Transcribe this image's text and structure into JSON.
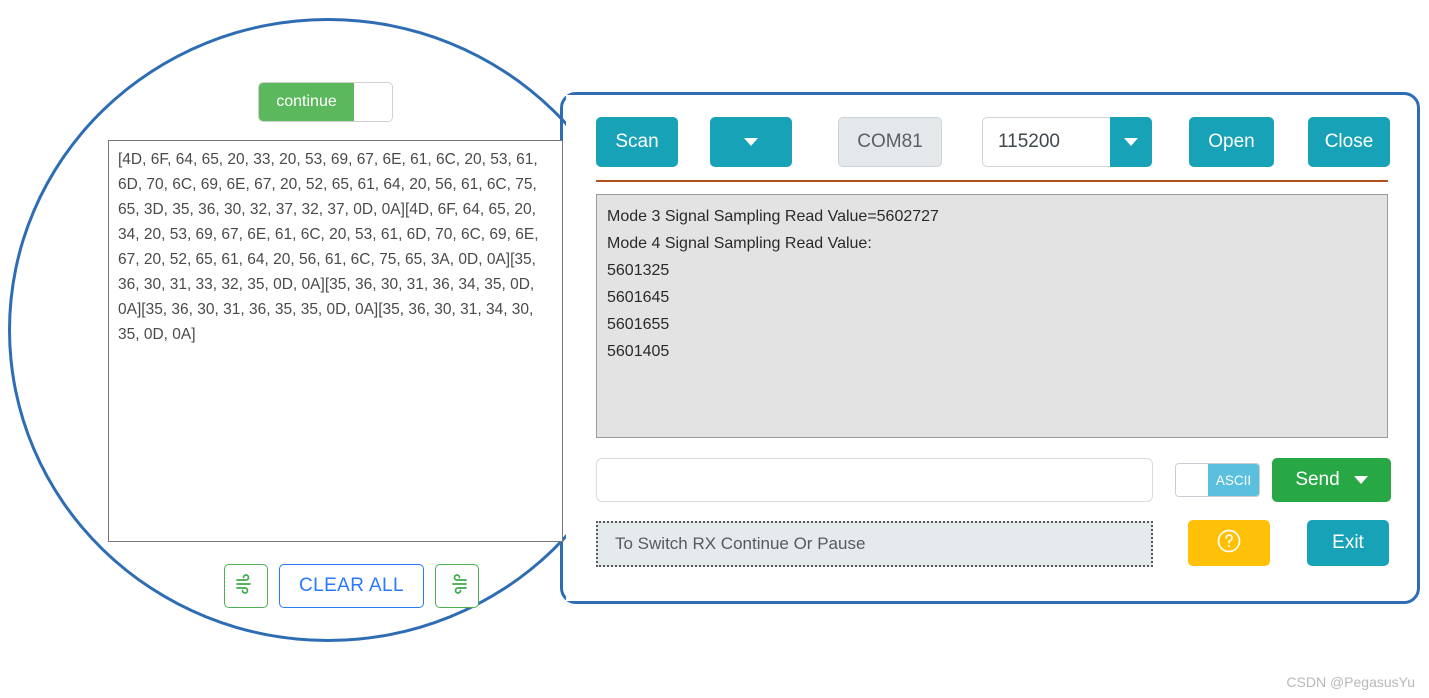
{
  "annotation": {
    "shape": "circle-highlight",
    "color": "#2e6db4"
  },
  "left_capture": {
    "continue_toggle": {
      "label": "continue",
      "state": "on",
      "on_color": "#5cb85c"
    },
    "hex_log": {
      "text": "[4D, 6F, 64, 65, 20, 33, 20, 53, 69, 67, 6E, 61, 6C, 20, 53, 61, 6D, 70, 6C, 69, 6E, 67, 20, 52, 65, 61, 64, 20, 56, 61, 6C, 75, 65, 3D, 35, 36, 30, 32, 37, 32, 37, 0D, 0A][4D, 6F, 64, 65, 20, 34, 20, 53, 69, 67, 6E, 61, 6C, 20, 53, 61, 6D, 70, 6C, 69, 6E, 67, 20, 52, 65, 61, 64, 20, 56, 61, 6C, 75, 65, 3A, 0D, 0A][35, 36, 30, 31, 33, 32, 35, 0D, 0A][35, 36, 30, 31, 36, 34, 35, 0D, 0A][35, 36, 30, 31, 36, 35, 35, 0D, 0A][35, 36, 30, 31, 34, 30, 35, 0D, 0A]"
    },
    "buttons": {
      "flow_start_icon": "wind-icon",
      "clear_all_label": "CLEAR ALL",
      "flow_stop_icon": "wind-icon"
    }
  },
  "panel": {
    "toolbar": {
      "scan_label": "Scan",
      "port_dropdown_icon": "chevron-down-icon",
      "com_port_value": "COM81",
      "baud_rate_value": "115200",
      "baud_dropdown_icon": "chevron-down-icon",
      "open_label": "Open",
      "close_label": "Close",
      "accent_color": "#17a2b8",
      "divider_color": "#b5501c"
    },
    "receive_box": {
      "lines": [
        "Mode 3 Signal Sampling Read Value=5602727",
        "Mode 4 Signal Sampling Read Value:",
        "5601325",
        "5601645",
        "5601655",
        "5601405"
      ]
    },
    "send_row": {
      "input_value": "",
      "input_placeholder": "",
      "ascii_toggle_label": "ASCII",
      "ascii_toggle_state": "on",
      "send_label": "Send",
      "send_dropdown_icon": "chevron-down-icon",
      "send_color": "#28a745"
    },
    "status_row": {
      "status_text": "To Switch RX Continue Or Pause",
      "help_icon": "question-circle-icon",
      "help_color": "#ffc107",
      "exit_label": "Exit",
      "exit_color": "#17a2b8"
    }
  },
  "watermark": {
    "text": "CSDN @PegasusYu"
  }
}
